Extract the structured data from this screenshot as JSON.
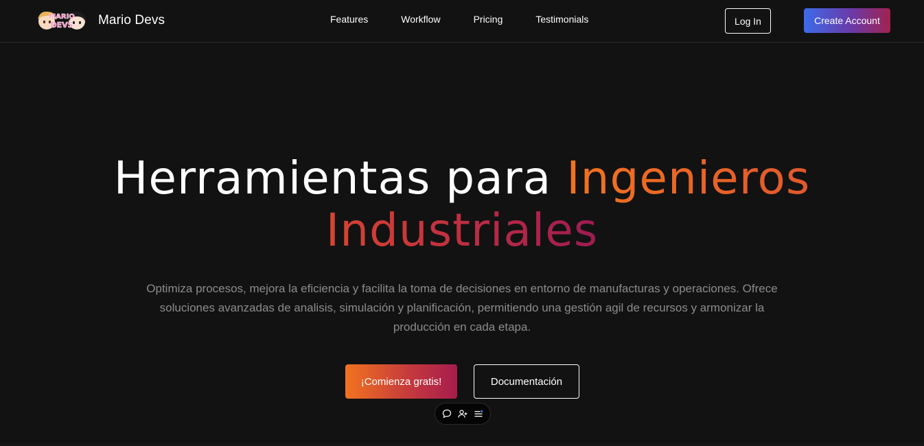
{
  "brand": {
    "name": "Mario Devs",
    "logo_text_top": "MARIO",
    "logo_text_bottom": "DEVS"
  },
  "nav": {
    "links": [
      "Features",
      "Workflow",
      "Pricing",
      "Testimonials"
    ],
    "login_label": "Log In",
    "create_label": "Create Account"
  },
  "hero": {
    "title_plain": "Herramientas para ",
    "title_accent_1": "Ingenieros",
    "title_accent_2": "Industriales",
    "description": "Optimiza procesos, mejora la eficiencia y facilita la toma de decisiones en entorno de manufacturas y operaciones. Ofrece soluciones avanzadas de analisis, simulación y planificación, permitiendo una gestión agil de recursos y armonizar la producción en cada etapa.",
    "cta_primary": "¡Comienza gratis!",
    "cta_secondary": "Documentación"
  },
  "float_toolbar": {
    "icons": [
      "chat-bubble-icon",
      "user-add-icon",
      "list-menu-icon"
    ]
  },
  "colors": {
    "background": "#121212",
    "accent_orange": "#f2731f",
    "accent_crimson": "#a61d4d",
    "accent_blue": "#3d6bea",
    "muted_text": "#8c8c8c"
  }
}
